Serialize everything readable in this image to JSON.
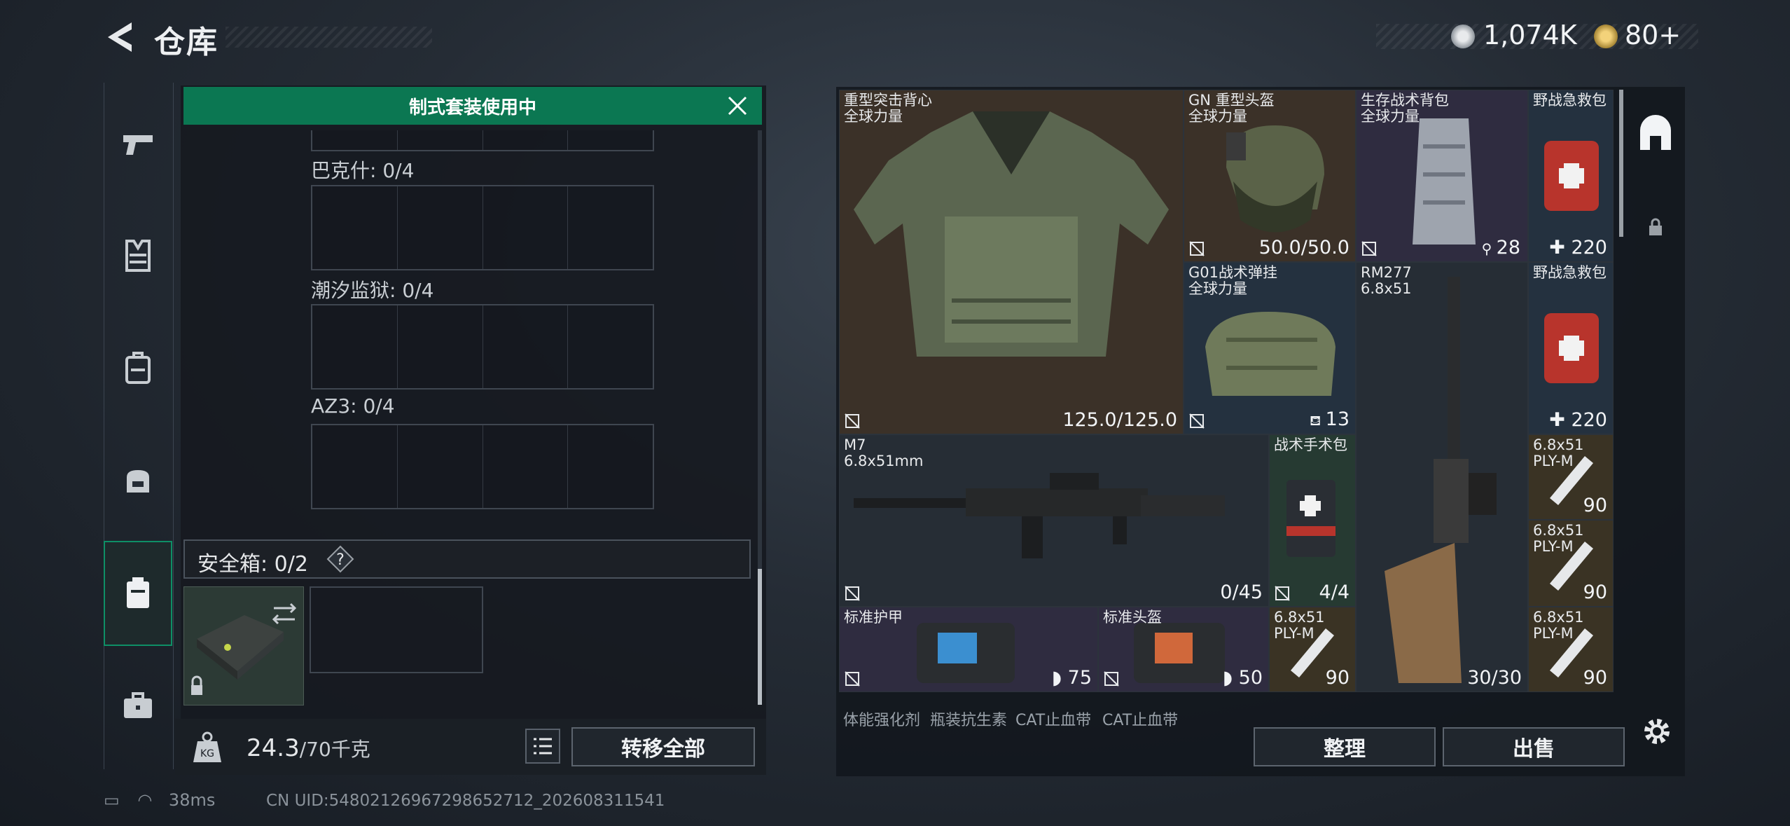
{
  "header": {
    "title": "仓库",
    "currency1_value": "1,074K",
    "currency2_value": "80+"
  },
  "sidebar": {
    "tabs": [
      {
        "name": "weapon-tab-icon"
      },
      {
        "name": "vest-tab-icon"
      },
      {
        "name": "backpack-tab-icon"
      },
      {
        "name": "helmet-bag-tab-icon"
      },
      {
        "name": "safebox-tab-icon",
        "active": true
      },
      {
        "name": "briefcase-tab-icon"
      }
    ]
  },
  "loadout": {
    "banner": "制式套装使用中",
    "sections": [
      {
        "label": "巴克什: 0/4"
      },
      {
        "label": "潮汐监狱: 0/4"
      },
      {
        "label": "AZ3: 0/4"
      }
    ],
    "safebox_label": "安全箱: 0/2",
    "weight_value": "24.3",
    "weight_unit": "/70千克",
    "transfer_all": "转移全部"
  },
  "inventory": {
    "items": [
      {
        "name": "重型突击背心\n全球力量",
        "value": "125.0/125.0"
      },
      {
        "name": "GN 重型头盔\n全球力量",
        "value": "50.0/50.0"
      },
      {
        "name": "生存战术背包\n全球力量",
        "value": "28"
      },
      {
        "name": "野战急救包",
        "value": "220"
      },
      {
        "name": "G01战术弹挂\n全球力量",
        "value": "13"
      },
      {
        "name": "RM277\n6.8x51",
        "value": "30/30"
      },
      {
        "name": "野战急救包",
        "value": "220"
      },
      {
        "name": "M7\n6.8x51mm",
        "value": "0/45"
      },
      {
        "name": "战术手术包",
        "value": "4/4"
      },
      {
        "name": "6.8x51\nPLY-M",
        "value": "90"
      },
      {
        "name": "6.8x51\nPLY-M",
        "value": "90"
      },
      {
        "name": "标准护甲",
        "value": "75"
      },
      {
        "name": "标准头盔",
        "value": "50"
      },
      {
        "name": "6.8x51\nPLY-M",
        "value": "90"
      },
      {
        "name": "6.8x51\nPLY-M",
        "value": "90"
      }
    ],
    "partial_row": [
      "体能强化剂",
      "瓶装抗生素",
      "CAT止血带",
      "CAT止血带"
    ],
    "sort_label": "整理",
    "sell_label": "出售"
  },
  "status": {
    "ping": "38ms",
    "uid": "CN UID:5480212696729865​2712_202608311541"
  },
  "colors": {
    "accent_green": "#0b7752",
    "vest_bg": "#3b3128",
    "blue_bg": "#24313f",
    "purple_bg": "#2f2c40",
    "gold_bg": "#3a3324"
  }
}
